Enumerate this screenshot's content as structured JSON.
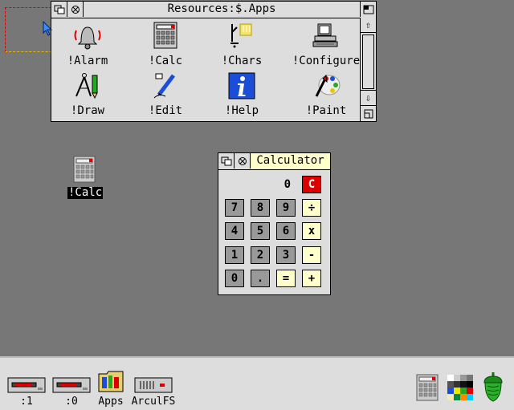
{
  "apps_window": {
    "title": "Resources:$.Apps",
    "icons": [
      {
        "label": "!Alarm",
        "icon": "bell-icon"
      },
      {
        "label": "!Calc",
        "icon": "calculator-icon"
      },
      {
        "label": "!Chars",
        "icon": "chars-icon"
      },
      {
        "label": "!Configure",
        "icon": "computer-icon"
      },
      {
        "label": "!Draw",
        "icon": "draw-compass-icon"
      },
      {
        "label": "!Edit",
        "icon": "edit-pen-icon"
      },
      {
        "label": "!Help",
        "icon": "info-icon"
      },
      {
        "label": "!Paint",
        "icon": "paint-brush-icon"
      }
    ]
  },
  "desktop": {
    "pinned_icon_label": "!Calc"
  },
  "calculator": {
    "title": "Calculator",
    "display": "0",
    "clear_label": "C",
    "keys": [
      "7",
      "8",
      "9",
      "÷",
      "4",
      "5",
      "6",
      "x",
      "1",
      "2",
      "3",
      "-",
      "0",
      ".",
      "=",
      "+"
    ]
  },
  "iconbar": {
    "items": [
      {
        "label": ":1",
        "icon": "floppy-drive-icon"
      },
      {
        "label": ":0",
        "icon": "floppy-drive-icon"
      },
      {
        "label": "Apps",
        "icon": "apps-folder-icon"
      },
      {
        "label": "ArculFS",
        "icon": "hard-drive-icon"
      }
    ],
    "right_icons": [
      "calculator-icon",
      "palette-icon",
      "acorn-icon"
    ]
  },
  "colors": {
    "desktop": "#777777",
    "window_bg": "#dddddd",
    "calc_title": "#ffffcc",
    "clear_key": "#dd0000",
    "acorn": "#22aa22"
  }
}
